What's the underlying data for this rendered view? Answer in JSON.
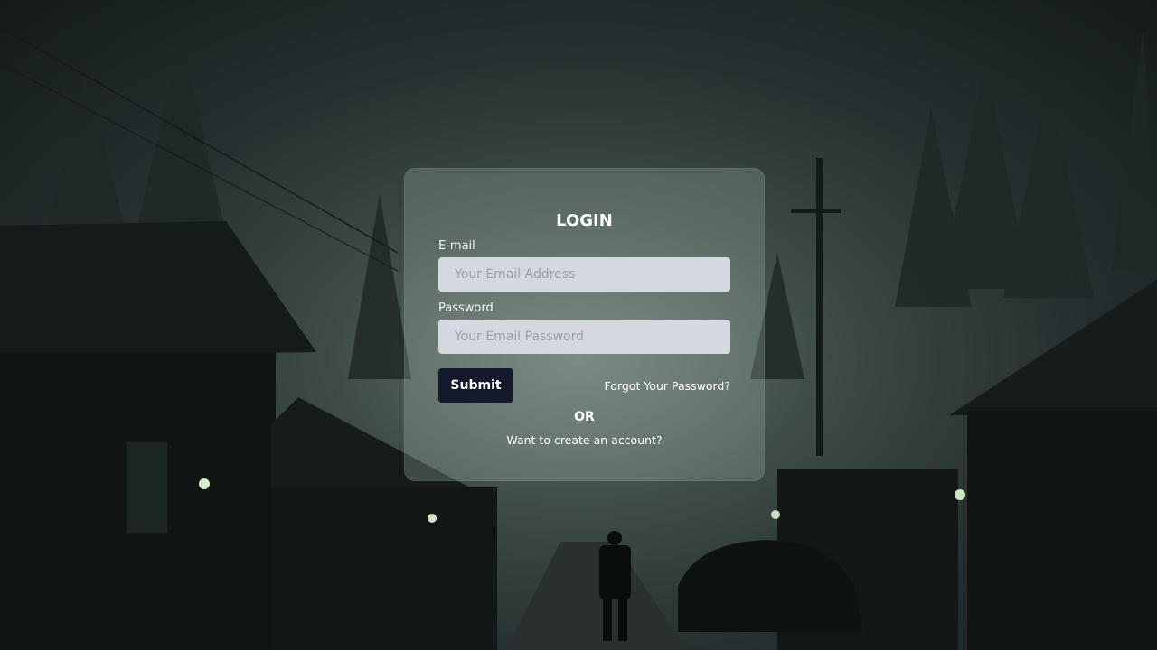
{
  "login_form": {
    "title": "LOGIN",
    "email_label": "E-mail",
    "email_placeholder": "Your Email Address",
    "email_value": "",
    "password_label": "Password",
    "password_placeholder": "Your Email Password",
    "password_value": "",
    "submit_label": "Submit",
    "forgot_link": "Forgot Your Password?",
    "or_text": "OR",
    "create_account_link": "Want to create an account?"
  },
  "colors": {
    "submit_button": "#141a2c",
    "input_background": "#d6d8df",
    "text": "#ffffff"
  }
}
